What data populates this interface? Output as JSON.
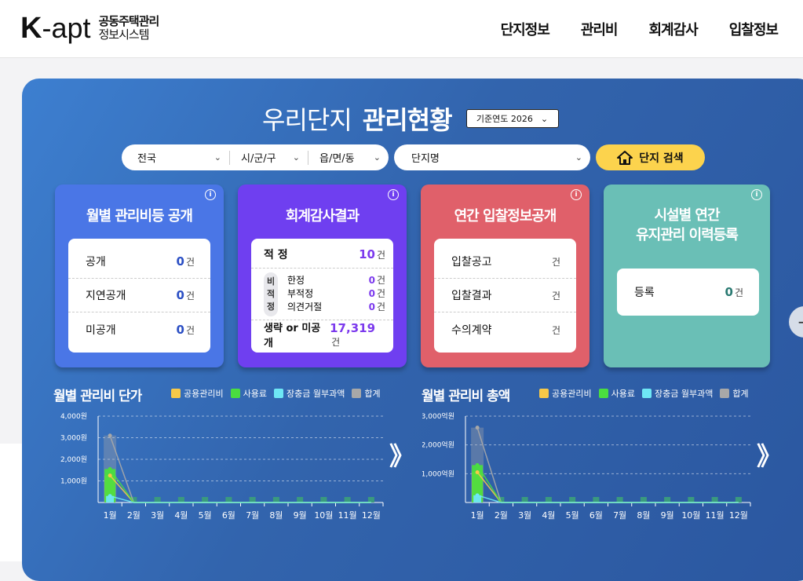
{
  "header": {
    "logo_k": "K",
    "logo_apt": "-apt",
    "logo_line1": "공동주택관리",
    "logo_line2": "정보시스템",
    "nav": [
      "단지정보",
      "관리비",
      "회계감사",
      "입찰정보"
    ]
  },
  "hero": {
    "title_light": "우리단지",
    "title_bold": "관리현황",
    "year_select": "기준연도 2026"
  },
  "search": {
    "sido": "전국",
    "sigungu": "시/군/구",
    "eupmyeondong": "읍/면/동",
    "apt_name": "단지명",
    "button": "단지 검색"
  },
  "cards": {
    "fee_disclosure": {
      "title": "월별 관리비등 공개",
      "rows": [
        {
          "label": "공개",
          "value": "0",
          "unit": "건"
        },
        {
          "label": "지연공개",
          "value": "0",
          "unit": "건"
        },
        {
          "label": "미공개",
          "value": "0",
          "unit": "건"
        }
      ]
    },
    "audit": {
      "title": "회계감사결과",
      "proper_label": "적 정",
      "proper_value": "10",
      "improper_tag": "비 적 정",
      "improper_rows": [
        {
          "label": "한정",
          "value": "0",
          "unit": "건"
        },
        {
          "label": "부적정",
          "value": "0",
          "unit": "건"
        },
        {
          "label": "의견거절",
          "value": "0",
          "unit": "건"
        }
      ],
      "omitted_label": "생략 or 미공개",
      "omitted_value": "17,319",
      "unit": "건"
    },
    "bidding": {
      "title": "연간 입찰정보공개",
      "rows": [
        {
          "label": "입찰공고",
          "value": "",
          "unit": "건"
        },
        {
          "label": "입찰결과",
          "value": "",
          "unit": "건"
        },
        {
          "label": "수의계약",
          "value": "",
          "unit": "건"
        }
      ]
    },
    "facility": {
      "title_line1": "시설별 연간",
      "title_line2": "유지관리 이력등록",
      "row_label": "등록",
      "row_value": "0",
      "unit": "건"
    }
  },
  "charts_header": {
    "unit_title": "월별 관리비 단가",
    "total_title": "월별 관리비 총액",
    "legend": [
      "공용관리비",
      "사용료",
      "장충금 월부과액",
      "합계"
    ]
  },
  "colors": {
    "common": "#f7c948",
    "usage": "#4ade3f",
    "reserve": "#6ee7f5",
    "total": "#a8a8a8",
    "button": "#fcd34d"
  },
  "chart_data": [
    {
      "type": "bar",
      "title": "월별 관리비 단가",
      "categories": [
        "1월",
        "2월",
        "3월",
        "4월",
        "5월",
        "6월",
        "7월",
        "8월",
        "9월",
        "10월",
        "11월",
        "12월"
      ],
      "y_ticks": [
        "4,000원",
        "3,000원",
        "2,000원",
        "1,000원"
      ],
      "ylim": [
        0,
        4000
      ],
      "series": [
        {
          "name": "공용관리비",
          "values": [
            1250,
            0,
            0,
            0,
            0,
            0,
            0,
            0,
            0,
            0,
            0,
            0
          ]
        },
        {
          "name": "사용료",
          "values": [
            1550,
            0,
            0,
            0,
            0,
            0,
            0,
            0,
            0,
            0,
            0,
            0
          ]
        },
        {
          "name": "장충금 월부과액",
          "values": [
            300,
            0,
            0,
            0,
            0,
            0,
            0,
            0,
            0,
            0,
            0,
            0
          ]
        },
        {
          "name": "합계",
          "values": [
            3100,
            0,
            0,
            0,
            0,
            0,
            0,
            0,
            0,
            0,
            0,
            0
          ]
        }
      ]
    },
    {
      "type": "bar",
      "title": "월별 관리비 총액",
      "categories": [
        "1월",
        "2월",
        "3월",
        "4월",
        "5월",
        "6월",
        "7월",
        "8월",
        "9월",
        "10월",
        "11월",
        "12월"
      ],
      "y_ticks": [
        "3,000억원",
        "2,000억원",
        "1,000억원"
      ],
      "ylim": [
        0,
        3000
      ],
      "series": [
        {
          "name": "공용관리비",
          "values": [
            1050,
            0,
            0,
            0,
            0,
            0,
            0,
            0,
            0,
            0,
            0,
            0
          ]
        },
        {
          "name": "사용료",
          "values": [
            1300,
            0,
            0,
            0,
            0,
            0,
            0,
            0,
            0,
            0,
            0,
            0
          ]
        },
        {
          "name": "장충금 월부과액",
          "values": [
            250,
            0,
            0,
            0,
            0,
            0,
            0,
            0,
            0,
            0,
            0,
            0
          ]
        },
        {
          "name": "합계",
          "values": [
            2600,
            0,
            0,
            0,
            0,
            0,
            0,
            0,
            0,
            0,
            0,
            0
          ]
        }
      ]
    }
  ]
}
